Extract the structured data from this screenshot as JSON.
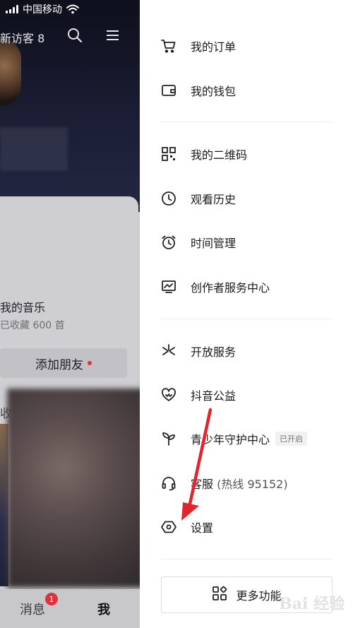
{
  "status_bar": {
    "carrier": "中国移动"
  },
  "profile": {
    "new_visitors": "新访客 8",
    "music_title": "我的音乐",
    "music_sub": "已收藏 600 首",
    "add_friend": "添加朋友",
    "partial_tab": "收"
  },
  "bottom_nav": {
    "messages": "消息",
    "messages_badge": "1",
    "me": "我"
  },
  "drawer": {
    "items": [
      {
        "label": "我的订单",
        "icon": "cart-icon"
      },
      {
        "label": "我的钱包",
        "icon": "wallet-icon"
      },
      {
        "label": "我的二维码",
        "icon": "qr-code-icon"
      },
      {
        "label": "观看历史",
        "icon": "clock-icon"
      },
      {
        "label": "时间管理",
        "icon": "alarm-icon"
      },
      {
        "label": "创作者服务中心",
        "icon": "chart-icon"
      },
      {
        "label": "开放服务",
        "icon": "sparkle-icon"
      },
      {
        "label": "抖音公益",
        "icon": "heart-icon"
      },
      {
        "label": "青少年守护中心",
        "icon": "sprout-icon",
        "status": "已开启"
      },
      {
        "label": "客服",
        "icon": "headset-icon",
        "extra": "(热线 95152)"
      },
      {
        "label": "设置",
        "icon": "settings-icon"
      }
    ],
    "more_button": "更多功能",
    "watermark": "Bai 经验"
  },
  "colors": {
    "accent_red": "#e0313f",
    "annotation_arrow": "#e3242b"
  }
}
